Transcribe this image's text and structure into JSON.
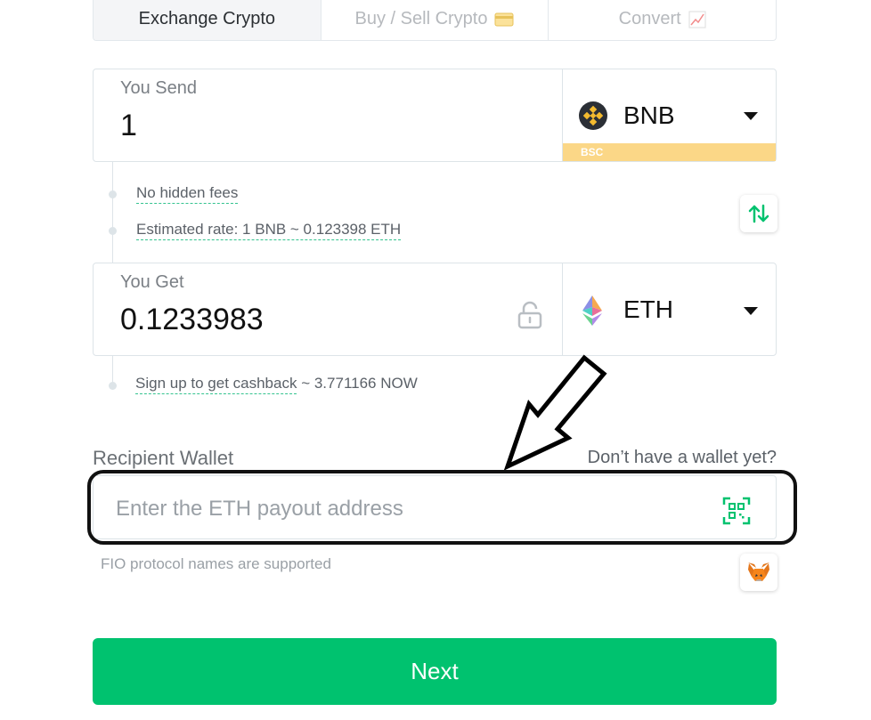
{
  "tabs": [
    {
      "label": "Exchange Crypto",
      "icon": null
    },
    {
      "label": "Buy / Sell Crypto",
      "icon": "credit-card-icon"
    },
    {
      "label": "Convert",
      "icon": "chart-icon"
    }
  ],
  "send": {
    "label": "You Send",
    "amount": "1",
    "currency": "BNB",
    "network": "BSC",
    "icon": "bnb-coin-icon"
  },
  "info": {
    "no_fees": "No hidden fees",
    "estimated_rate": "Estimated rate: 1 BNB ~ 0.123398 ETH",
    "cashback_link": "Sign up to get cashback",
    "cashback_value": "~ 3.771166 NOW"
  },
  "get": {
    "label": "You Get",
    "amount": "0.1233983",
    "currency": "ETH",
    "icon": "eth-coin-icon"
  },
  "wallet": {
    "label": "Recipient Wallet",
    "no_wallet_link": "Don’t have a wallet yet?",
    "placeholder": "Enter the ETH payout address",
    "fio_note": "FIO protocol names are supported"
  },
  "next_label": "Next",
  "colors": {
    "accent": "#00c26f",
    "bnb": "#f3ba2f",
    "bsc_tag": "#fbd787"
  }
}
